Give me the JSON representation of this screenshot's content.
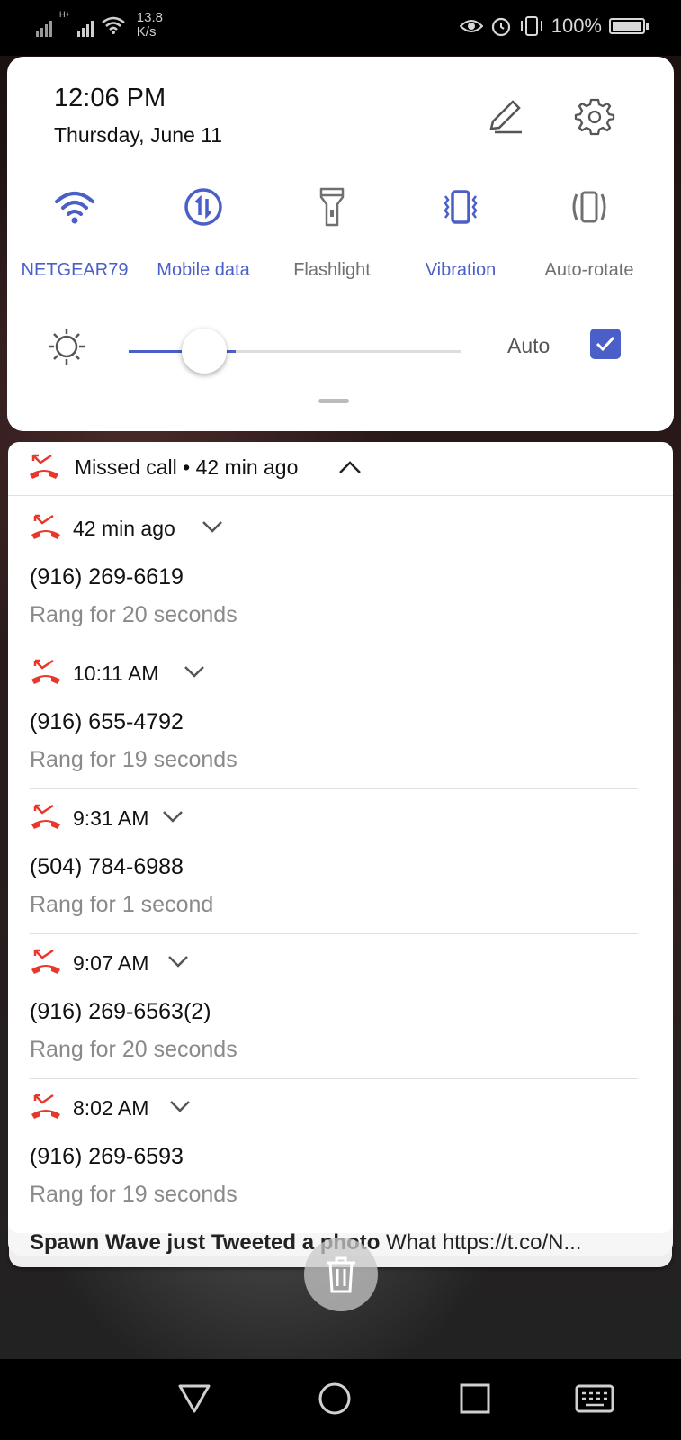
{
  "status_bar": {
    "network_type": "H+",
    "speed_value": "13.8",
    "speed_unit": "K/s",
    "battery": "100%",
    "icons": [
      "eye-icon",
      "alarm-icon",
      "vibrate-icon",
      "battery-icon"
    ]
  },
  "quick_settings": {
    "time": "12:06 PM",
    "date": "Thursday, June 11",
    "tiles": [
      {
        "label": "NETGEAR79",
        "icon": "wifi-icon",
        "active": true
      },
      {
        "label": "Mobile data",
        "icon": "mobile-data-icon",
        "active": true
      },
      {
        "label": "Flashlight",
        "icon": "flashlight-icon",
        "active": false
      },
      {
        "label": "Vibration",
        "icon": "vibration-icon",
        "active": true
      },
      {
        "label": "Auto-rotate",
        "icon": "auto-rotate-icon",
        "active": false
      }
    ],
    "brightness": {
      "level": 0.16,
      "auto_label": "Auto",
      "auto_checked": true
    },
    "accent_color": "#4a5fc7"
  },
  "notification": {
    "header": "Missed call • 42 min ago",
    "accent_color": "#e8382c",
    "calls": [
      {
        "time": "42 min ago",
        "number": "(916) 269-6619",
        "duration": "Rang for 20 seconds"
      },
      {
        "time": "10:11 AM",
        "number": "(916) 655-4792",
        "duration": "Rang for 19 seconds"
      },
      {
        "time": "9:31 AM",
        "number": "(504) 784-6988",
        "duration": "Rang for 1 second"
      },
      {
        "time": "9:07 AM",
        "number": "(916) 269-6563(2)",
        "duration": "Rang for 20 seconds"
      },
      {
        "time": "8:02 AM",
        "number": "(916) 269-6593",
        "duration": "Rang for 19 seconds"
      }
    ]
  },
  "peek_notification": {
    "title": "Spawn Wave just Tweeted a photo",
    "text": " What https://t.co/N..."
  },
  "navigation": [
    "back-button",
    "home-button",
    "recents-button",
    "keyboard-button"
  ]
}
